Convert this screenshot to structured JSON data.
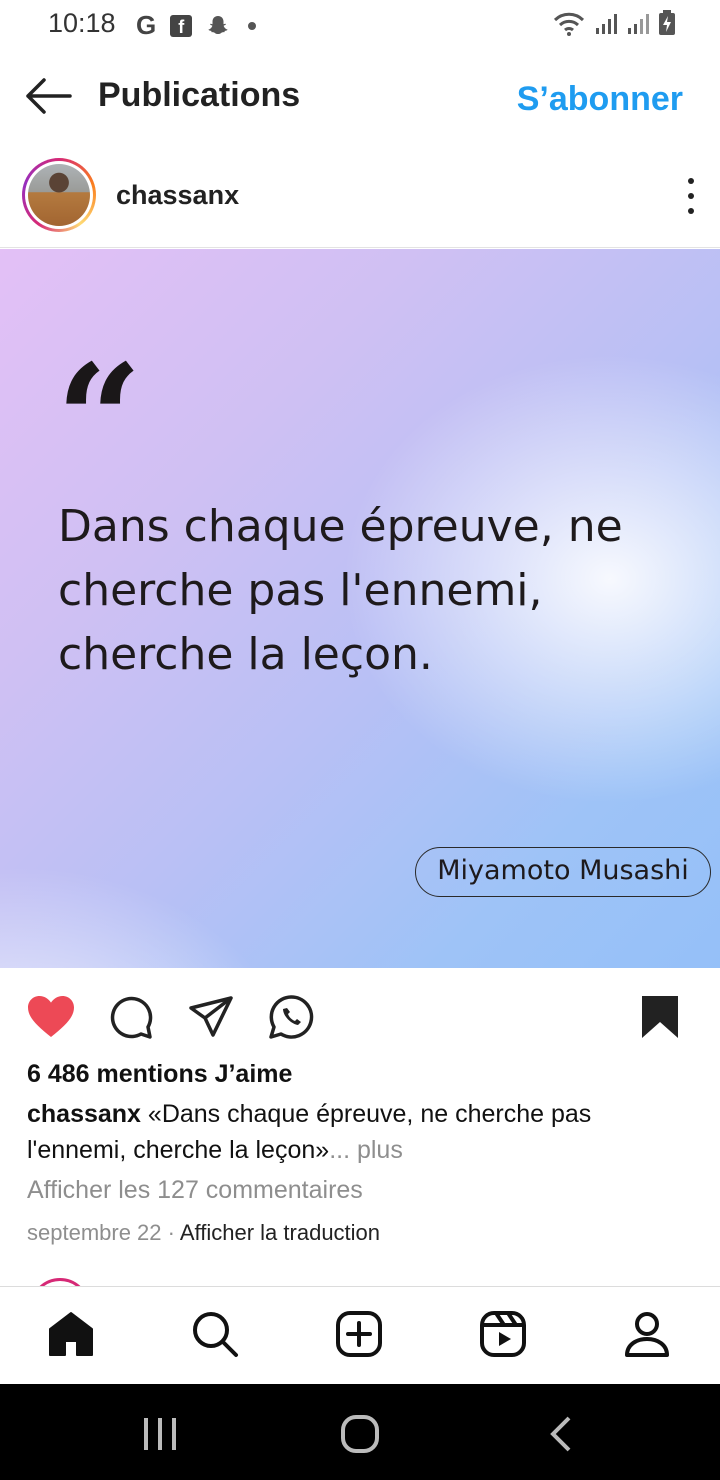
{
  "status_bar": {
    "time": "10:18",
    "app_icons": [
      "google-icon",
      "facebook-icon",
      "snapchat-icon",
      "dot-icon"
    ],
    "g_label": "G",
    "fb_label": "f"
  },
  "header": {
    "title": "Publications",
    "subscribe_label": "S’abonner"
  },
  "post": {
    "username": "chassanx",
    "quote_mark": "“",
    "quote_text": "Dans chaque épreuve, ne cherche pas l'ennemi, cherche la leçon.",
    "quote_author": "Miyamoto Musashi",
    "likes": "6 486 mentions J’aime",
    "caption_user": "chassanx",
    "caption_text": " «Dans chaque épreuve, ne cherche pas l'ennemi, cherche la leçon»",
    "caption_more": "... plus",
    "comments_link": "Afficher les 127 commentaires",
    "date": "septembre 22",
    "separator": " · ",
    "translate_label": "Afficher la traduction",
    "liked": true,
    "saved": true
  },
  "colors": {
    "accent": "#1f9cf0",
    "like": "#ed4956"
  }
}
